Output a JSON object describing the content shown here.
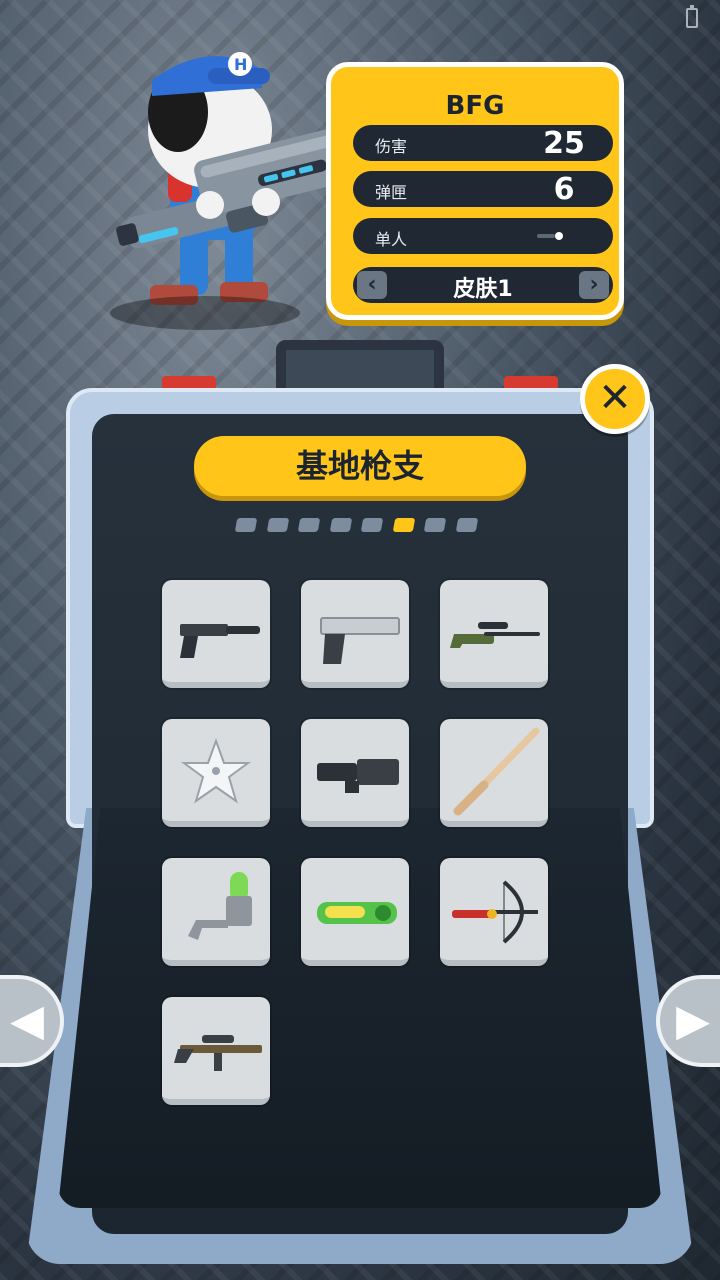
{
  "weapon": {
    "name": "BFG",
    "damage_label": "伤害",
    "damage_value": "25",
    "ammo_label": "弹匣",
    "ammo_value": "6",
    "fire_mode_label": "单人",
    "skin_label": "皮肤1"
  },
  "panel": {
    "title": "基地枪支",
    "page_count": 8,
    "active_page": 6
  },
  "weapons_grid": [
    {
      "icon": "silenced-pistol-icon"
    },
    {
      "icon": "desert-eagle-icon"
    },
    {
      "icon": "sniper-rifle-icon"
    },
    {
      "icon": "shuriken-icon"
    },
    {
      "icon": "heavy-blaster-icon"
    },
    {
      "icon": "magic-wand-icon"
    },
    {
      "icon": "grenade-launcher-icon"
    },
    {
      "icon": "water-gun-icon"
    },
    {
      "icon": "crossbow-icon"
    },
    {
      "icon": "assault-rifle-icon"
    }
  ],
  "colors": {
    "accent_yellow": "#ffc619",
    "dark_navy": "#1f2833",
    "case_blue": "#b9cde4",
    "clasp_red": "#d73b2f"
  }
}
